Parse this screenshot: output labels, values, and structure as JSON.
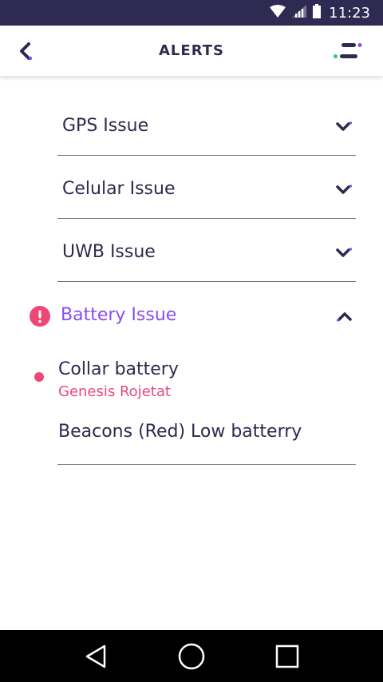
{
  "status_bar": {
    "time": "11:23",
    "icons": [
      "wifi-icon",
      "signal-icon",
      "battery-icon"
    ]
  },
  "app_bar": {
    "title": "ALERTS",
    "back_icon": "chevron-left-icon",
    "menu_icon": "menu-icon"
  },
  "alerts": {
    "items": [
      {
        "label": "GPS Issue",
        "expanded": false
      },
      {
        "label": "Celular Issue",
        "expanded": false
      },
      {
        "label": "UWB Issue",
        "expanded": false
      }
    ],
    "active": {
      "label": "Battery Issue",
      "expanded": true,
      "warning_icon": "exclamation-icon",
      "sub_items": [
        {
          "title": "Collar battery",
          "subtitle": "Genesis Rojetat"
        },
        {
          "title": "Beacons (Red) Low batterry"
        }
      ]
    }
  },
  "nav_bar": {
    "icons": [
      "back-triangle-icon",
      "home-circle-icon",
      "recents-square-icon"
    ]
  },
  "colors": {
    "primary": "#2d2b4e",
    "accent_purple": "#8a4cf0",
    "accent_pink": "#ef4775",
    "accent_green": "#2ecc71",
    "status_bar": "#2e2a52"
  }
}
